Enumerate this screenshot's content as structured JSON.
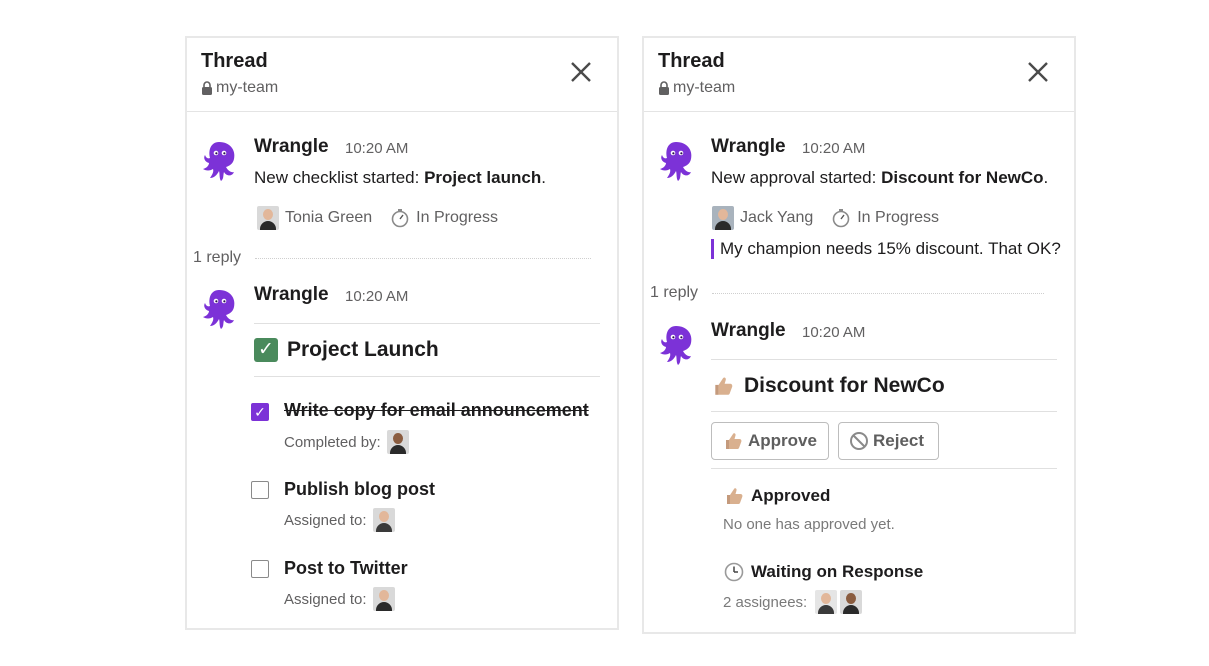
{
  "colors": {
    "brand": "#7c32d7",
    "check_emoji": "#4a8a5c"
  },
  "icons": {
    "close": "close-icon",
    "lock": "lock-icon",
    "bot": "octopus-icon",
    "stopwatch": "stopwatch-icon",
    "thumbs_up": "thumbs-up-icon",
    "no_entry": "no-entry-icon",
    "clock": "clock-icon",
    "check_emoji": "check-box-emoji-icon"
  },
  "left_thread": {
    "header": {
      "title": "Thread",
      "channel": "my-team"
    },
    "parent": {
      "author": "Wrangle",
      "time": "10:20 AM",
      "text_prefix": "New checklist started: ",
      "text_bold": "Project launch",
      "text_suffix": ".",
      "assignee": "Tonia Green",
      "status": "In Progress"
    },
    "reply_count": "1 reply",
    "reply": {
      "author": "Wrangle",
      "time": "10:20 AM",
      "card_title": "Project Launch",
      "items": [
        {
          "label": "Write copy for email announcement",
          "checked": true,
          "sub_label": "Completed by:"
        },
        {
          "label": "Publish blog post",
          "checked": false,
          "sub_label": "Assigned to:"
        },
        {
          "label": "Post to Twitter",
          "checked": false,
          "sub_label": "Assigned to:"
        }
      ]
    }
  },
  "right_thread": {
    "header": {
      "title": "Thread",
      "channel": "my-team"
    },
    "parent": {
      "author": "Wrangle",
      "time": "10:20 AM",
      "text_prefix": "New approval started: ",
      "text_bold": "Discount for NewCo",
      "text_suffix": ".",
      "assignee": "Jack Yang",
      "status": "In Progress",
      "quote": "My champion needs 15% discount. That OK?"
    },
    "reply_count": "1 reply",
    "reply": {
      "author": "Wrangle",
      "time": "10:20 AM",
      "card_title": "Discount for NewCo",
      "approve_label": "Approve",
      "reject_label": "Reject",
      "approved_title": "Approved",
      "approved_text": "No one has approved yet.",
      "waiting_title": "Waiting on Response",
      "waiting_text": "2 assignees:"
    }
  }
}
